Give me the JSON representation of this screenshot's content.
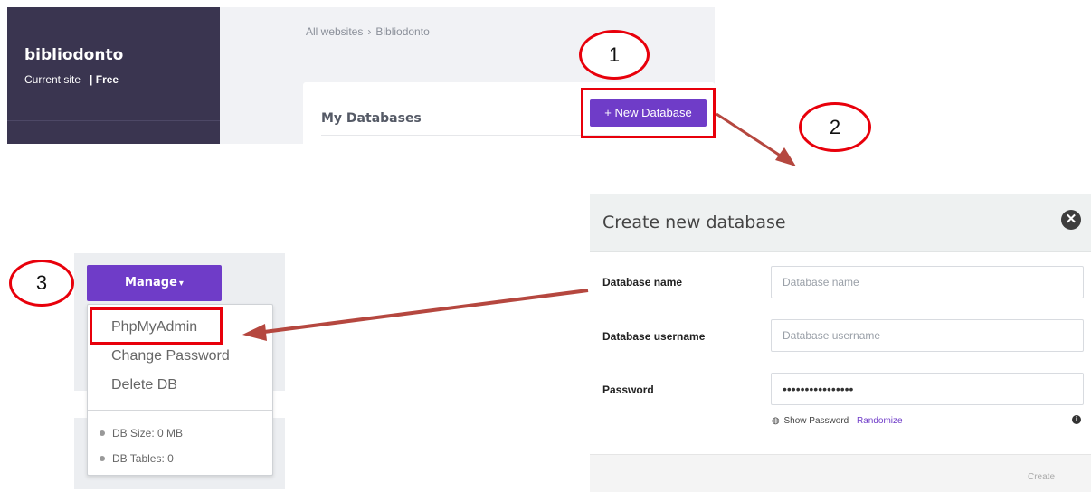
{
  "site": {
    "name": "bibliodonto",
    "current_label": "Current site",
    "plan": "| Free"
  },
  "breadcrumb": {
    "root": "All websites",
    "separator": "›",
    "current": "Bibliodonto"
  },
  "databases_card": {
    "title": "My Databases",
    "new_button": "+ New Database"
  },
  "steps": [
    "1",
    "2",
    "3"
  ],
  "modal": {
    "title": "Create new database",
    "close_icon": "close-circle-icon",
    "fields": [
      {
        "label": "Database name",
        "placeholder": "Database name",
        "value": ""
      },
      {
        "label": "Database username",
        "placeholder": "Database username",
        "value": ""
      },
      {
        "label": "Password",
        "placeholder": "",
        "value": "••••••••••••••••"
      }
    ],
    "show_password": "Show Password",
    "randomize": "Randomize",
    "info_icon": "info-icon",
    "create_button": "Create"
  },
  "manage": {
    "button": "Manage",
    "caret": "▾",
    "items": [
      "PhpMyAdmin",
      "Change Password",
      "Delete DB"
    ],
    "stats": [
      "DB Size: 0 MB",
      "DB Tables: 0"
    ]
  },
  "colors": {
    "sidebar": "#3a3550",
    "accent_purple": "#6f3cc8",
    "highlight_red": "#e8000b",
    "arrow_red": "#b5473f"
  }
}
